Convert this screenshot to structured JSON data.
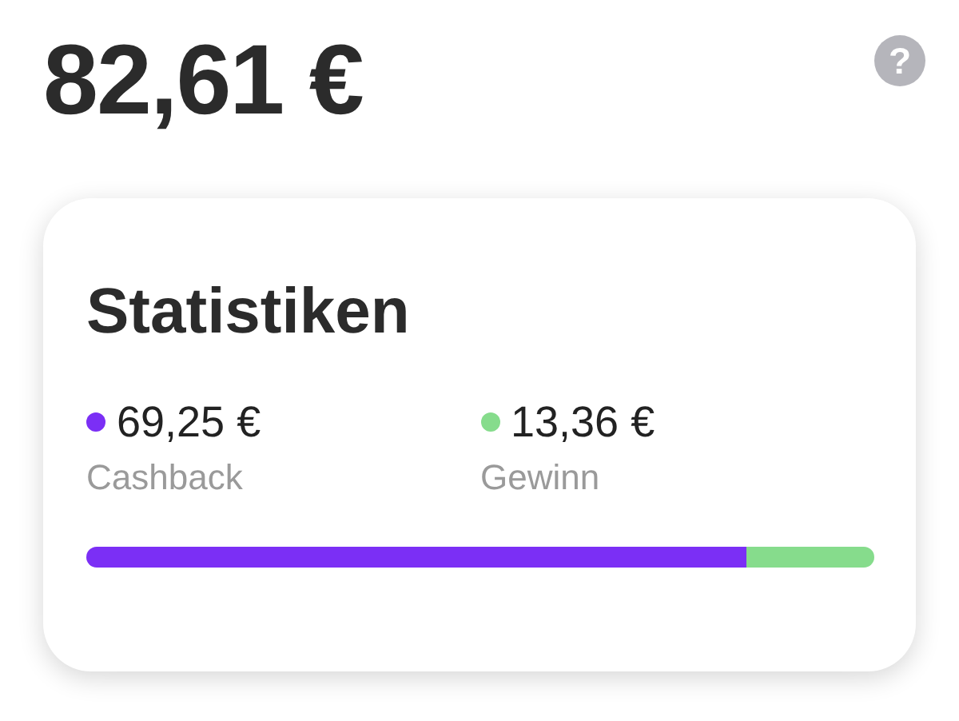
{
  "balance": "82,61 €",
  "help": "?",
  "card": {
    "title": "Statistiken",
    "items": [
      {
        "amount": "69,25 €",
        "label": "Cashback",
        "color": "#7b2ff5"
      },
      {
        "amount": "13,36 €",
        "label": "Gewinn",
        "color": "#86dc8c"
      }
    ],
    "bar": {
      "level": 0.838
    }
  }
}
